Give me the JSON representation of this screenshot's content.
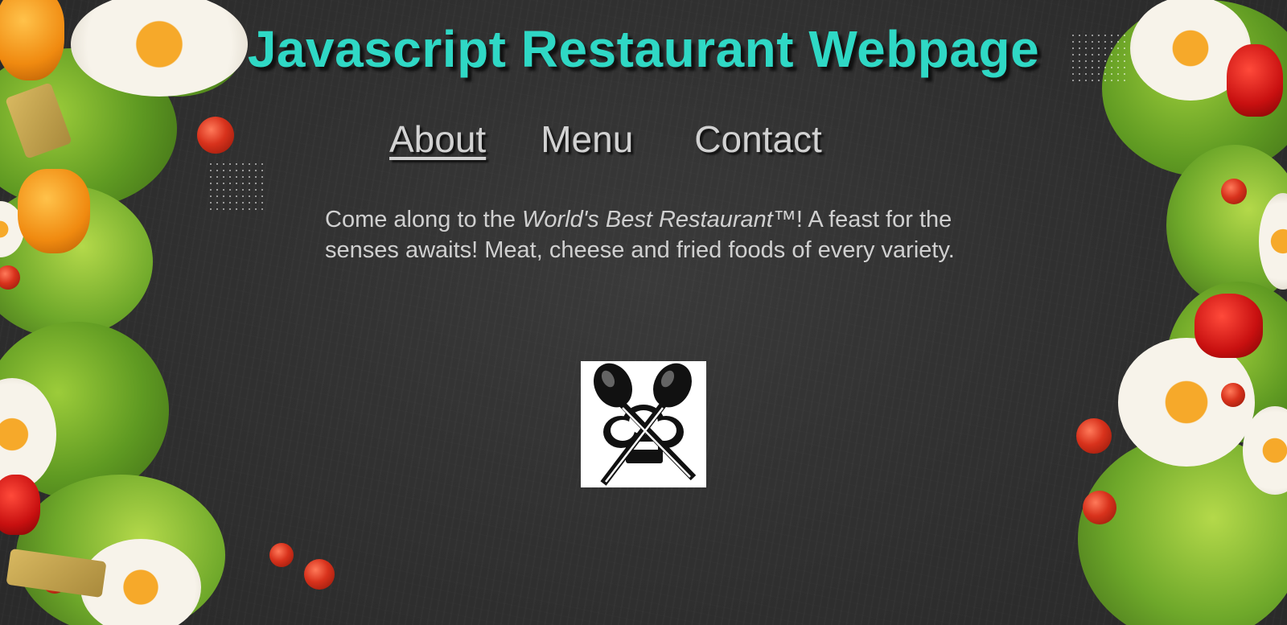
{
  "page": {
    "title": "Javascript Restaurant Webpage"
  },
  "nav": {
    "items": [
      {
        "label": "About",
        "active": true
      },
      {
        "label": "Menu",
        "active": false
      },
      {
        "label": "Contact",
        "active": false
      }
    ]
  },
  "about": {
    "text_before": "Come along to the ",
    "restaurant_name": "World's Best Restaurant",
    "text_after": "™! A feast for the senses awaits! Meat, cheese and fried foods of every variety."
  },
  "logo": {
    "icon": "crossed-spoons-chef-hat-icon"
  },
  "colors": {
    "title": "#2fd8c5",
    "nav_text": "#d2d2d2",
    "body_text": "#d0d0d0",
    "background": "#323232"
  }
}
